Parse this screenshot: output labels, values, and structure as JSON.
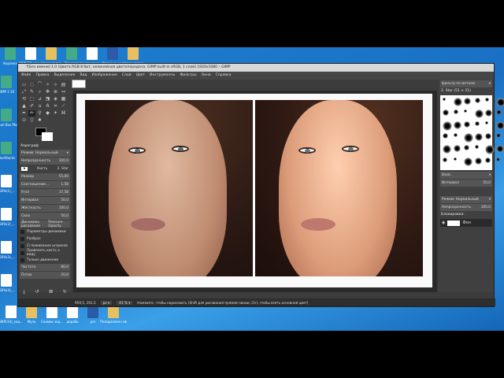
{
  "desktop": {
    "icons_top": [
      "Корзина",
      "ВКР(ЭЗ)_зад...",
      "Новая папка",
      "Telegram",
      "приложение на",
      "Сегодня как",
      "Новая папка"
    ],
    "icons_left": [
      "GIMP 2.10",
      "Virtual Box Plus",
      "BlueStacks",
      "456%(1)_...",
      "456%(2)_...",
      "456%(3)_...",
      "456%(4)_..."
    ],
    "icons_bottom": [
      "ВКР(ЭЗ)_зад...",
      "Муза",
      "Снимок экр...",
      "дорабо",
      "per",
      "Полоразличн ев"
    ]
  },
  "window": {
    "title": "*[Без имени]-1.0 (Цвета RGB 8 бит, нелинейная цветопередача, GIMP built-in sRGB, 1 слой) 1920x1080 – GIMP"
  },
  "menu": [
    "Файл",
    "Правка",
    "Выделение",
    "Вид",
    "Изображение",
    "Слой",
    "Цвет",
    "Инструменты",
    "Фильтры",
    "Окна",
    "Справка"
  ],
  "tool_options": {
    "title": "Аэрограф",
    "mode": "Режим: Нормальный",
    "opacity_label": "Непрозрачность",
    "opacity": "100,0",
    "brush_label": "Кисть",
    "brush": "2. Star",
    "params": [
      {
        "label": "Размер",
        "value": "55,00"
      },
      {
        "label": "Соотношение...",
        "value": "1,58"
      },
      {
        "label": "Угол",
        "value": "17,58"
      },
      {
        "label": "Интервал",
        "value": "50,0"
      },
      {
        "label": "Жёсткость",
        "value": "100,0"
      },
      {
        "label": "Сила",
        "value": "50,0"
      }
    ],
    "dynamics_label": "Динамика рисования",
    "dynamics": "Pressure Opacity",
    "checks": [
      "Параметры динамики",
      "Разброс",
      "Сглаживание штрихов",
      "Привязать кисть к виду",
      "Только движение"
    ],
    "rate_label": "Частота",
    "rate": "80,0",
    "flow_label": "Поток",
    "flow": "20,0"
  },
  "brushes": {
    "filter": "фильтр по меткам",
    "current": "2. Star (51 × 51)",
    "preset": "Basic.",
    "spacing_label": "Интервал",
    "spacing": "50,0"
  },
  "layers": {
    "mode": "Режим: Нормальный",
    "opacity_label": "Непрозрачность",
    "opacity": "100,0",
    "lock_label": "Блокировка:",
    "layer_name": "Фон"
  },
  "status": {
    "coords": "959,5, 201,5",
    "unit": "px",
    "zoom": "41 %",
    "message": "Нажмите, чтобы нарисовать (Shift для рисования прямой линии, Ctrl, чтобы взять основной цвет)"
  }
}
